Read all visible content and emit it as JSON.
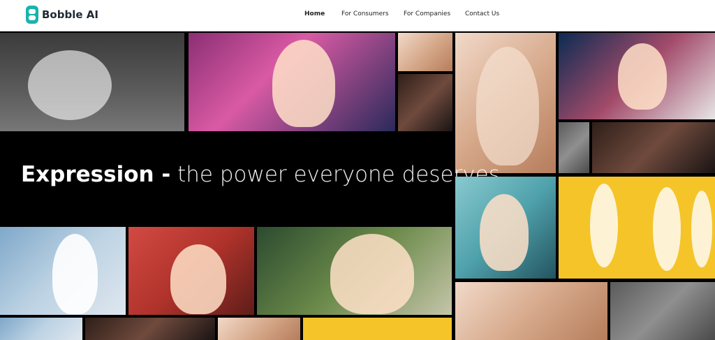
{
  "brand": {
    "name": "Bobble AI"
  },
  "nav": {
    "items": [
      {
        "label": "Home",
        "active": true
      },
      {
        "label": "For Consumers",
        "active": false
      },
      {
        "label": "For Companies",
        "active": false
      },
      {
        "label": "Contact Us",
        "active": false
      }
    ]
  },
  "hero": {
    "title_strong": "Expression -",
    "title_light": " the power everyone deserves"
  },
  "colors": {
    "logo": "#17b4ab",
    "background": "#000000"
  }
}
